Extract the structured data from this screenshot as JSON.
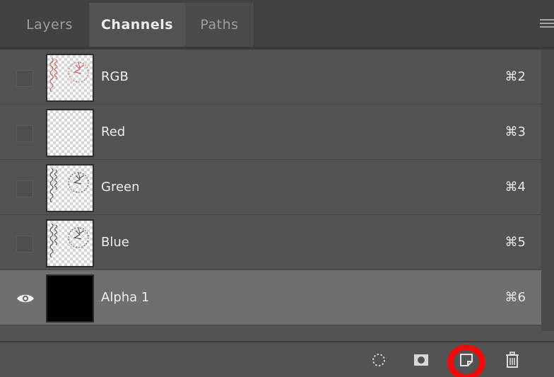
{
  "tabs": [
    {
      "label": "Layers"
    },
    {
      "label": "Channels"
    },
    {
      "label": "Paths"
    }
  ],
  "channels": [
    {
      "name": "RGB",
      "shortcut": "⌘2",
      "visible": false,
      "selected": false,
      "thumbnail": "rgb-sketch"
    },
    {
      "name": "Red",
      "shortcut": "⌘3",
      "visible": false,
      "selected": false,
      "thumbnail": "transparent"
    },
    {
      "name": "Green",
      "shortcut": "⌘4",
      "visible": false,
      "selected": false,
      "thumbnail": "gray-sketch"
    },
    {
      "name": "Blue",
      "shortcut": "⌘5",
      "visible": false,
      "selected": false,
      "thumbnail": "gray-sketch"
    },
    {
      "name": "Alpha 1",
      "shortcut": "⌘6",
      "visible": true,
      "selected": true,
      "thumbnail": "black"
    }
  ],
  "footer": {
    "tools": [
      {
        "icon": "load-selection-icon"
      },
      {
        "icon": "save-selection-icon"
      },
      {
        "icon": "new-channel-icon",
        "highlighted": true
      },
      {
        "icon": "trash-icon"
      }
    ]
  },
  "colors": {
    "panel": "#535353",
    "tab_bar": "#424242",
    "selected_row": "#6f6f6f",
    "highlight": "#ee0b0b"
  }
}
